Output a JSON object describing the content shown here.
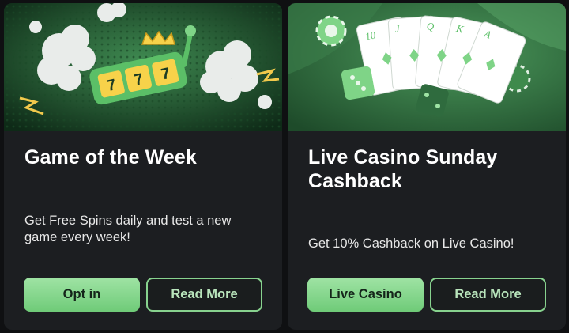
{
  "cards": [
    {
      "title": "Game of the Week",
      "description": "Get Free Spins daily and test a new game every week!",
      "primary_button": "Opt in",
      "secondary_button": "Read More",
      "banner": {
        "icon": "slot-machine-illustration",
        "reel_symbols": [
          "7",
          "7",
          "7"
        ]
      }
    },
    {
      "title": "Live Casino Sunday Cashback",
      "description": "Get 10% Cashback on Live Casino!",
      "primary_button": "Live Casino",
      "secondary_button": "Read More",
      "banner": {
        "icon": "playing-cards-illustration",
        "card_ranks": [
          "10",
          "J",
          "Q",
          "K",
          "A"
        ]
      }
    }
  ],
  "colors": {
    "accent": "#7fd487",
    "card_bg": "#1c1e21",
    "page_bg": "#0f1012",
    "banner_bg": "#2f6b3e"
  }
}
